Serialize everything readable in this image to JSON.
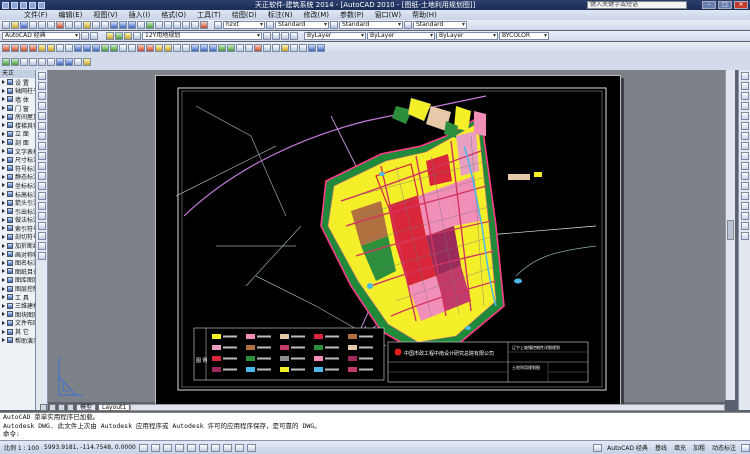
{
  "title": "天正软件-建筑系统 2014 - [AutoCAD 2010 - [图纸-土地利用规划图]]",
  "search_placeholder": "键入关键字或短语",
  "menu": [
    "文件(F)",
    "编辑(E)",
    "视图(V)",
    "插入(I)",
    "格式(O)",
    "工具(T)",
    "绘图(D)",
    "标注(N)",
    "修改(M)",
    "参数(P)",
    "窗口(W)",
    "帮助(H)"
  ],
  "toolbar": {
    "text_style": "hzxt",
    "dim_style": "Standard",
    "table_style": "Standard",
    "ml_style": "Standard",
    "workspace": "AutoCAD 经典",
    "layer": "12Y用地规划",
    "color": "ByLayer",
    "linetype": "ByLayer",
    "lineweight": "ByLayer",
    "plot_style": "BYCOLOR"
  },
  "palette": {
    "title": "天正",
    "items": [
      "设 置",
      "轴网柱子",
      "墙 体",
      "门 窗",
      "房间屋顶",
      "楼梯其他",
      "立 面",
      "剖 面",
      "文字表格",
      "尺寸标注",
      "符号标注",
      "静态标注",
      "坐标标注",
      "标高标注",
      "箭头引注",
      "引出标注",
      "做法标注",
      "索引符号",
      "剖切符号",
      "加折断线",
      "画对称轴",
      "图名标注",
      "图纸目录",
      "图库图案",
      "图层控制",
      "工 具",
      "三维建模",
      "图块图案",
      "文件布图",
      "其 它",
      "帮助演示"
    ]
  },
  "tabs": [
    "模型",
    "Layout1"
  ],
  "command_lines": [
    "AutoCAD 菜单实用程序已加载。",
    "Autodesk DWG.  此文件上次由 Autodesk 应用程序或 Autodesk 许可的应用程序保存，是可靠的 DWG。",
    "命令:"
  ],
  "status": {
    "scale": "比例 1 : 100",
    "coords": "5993.9181, -114.7548, 0.0000",
    "workspace": "AutoCAD 经典",
    "right_items": [
      "基线",
      "填充",
      "加粗",
      "动态标注"
    ]
  },
  "drawing": {
    "title_block_company": "中国市政工程中南设计研究总院有限公司",
    "title_block_project": "辽宁上坡镇控制性详细规划",
    "title_block_drawing": "土地利用规划图",
    "legend_label": "图 例"
  },
  "colors": {
    "residential": "#f5ef2a",
    "commercial": "#d9263a",
    "public": "#f28fb8",
    "green": "#2d8f3c",
    "industrial": "#b07040",
    "road": "#e6c9a8",
    "water": "#4ab8e8",
    "boundary": "#ff3b8a"
  }
}
